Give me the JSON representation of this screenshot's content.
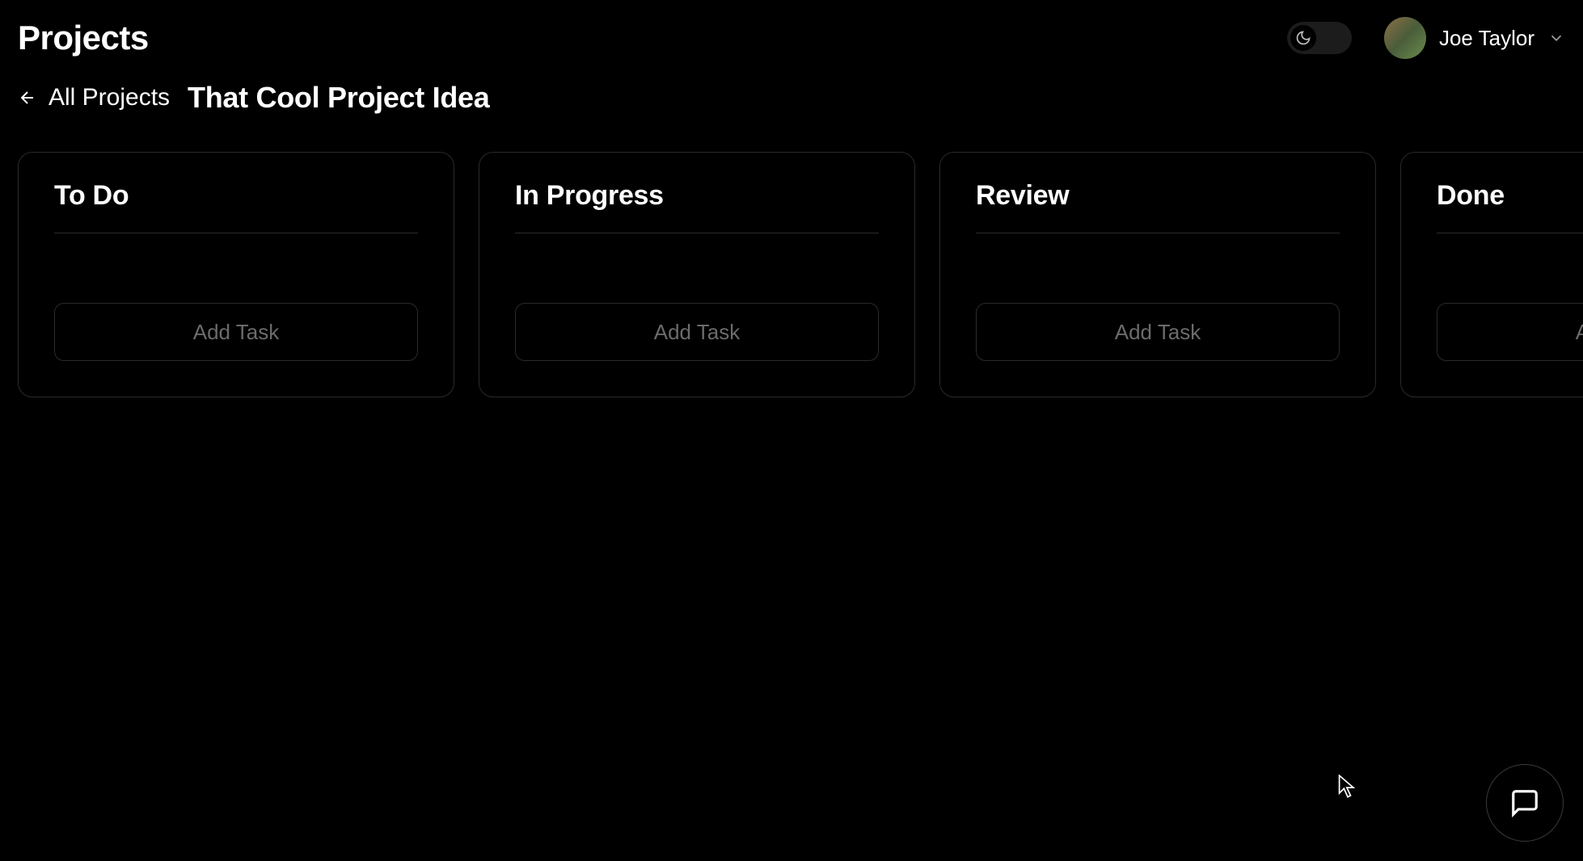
{
  "header": {
    "page_title": "Projects",
    "user_name": "Joe Taylor"
  },
  "breadcrumb": {
    "back_label": "All Projects",
    "project_title": "That Cool Project Idea"
  },
  "board": {
    "columns": [
      {
        "title": "To Do",
        "add_label": "Add Task"
      },
      {
        "title": "In Progress",
        "add_label": "Add Task"
      },
      {
        "title": "Review",
        "add_label": "Add Task"
      },
      {
        "title": "Done",
        "add_label": "Add Task"
      }
    ]
  }
}
